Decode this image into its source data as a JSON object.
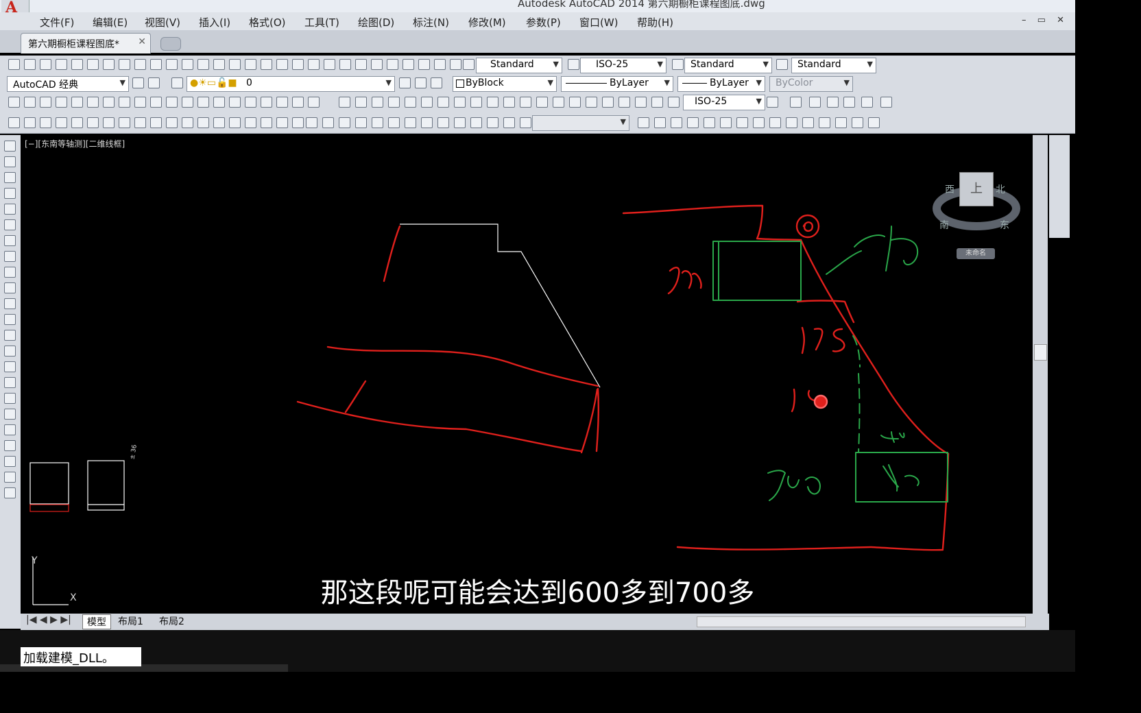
{
  "window": {
    "title": "Autodesk AutoCAD 2014    第六期橱柜课程图底.dwg",
    "controls": "– ▭ ✕"
  },
  "menu": [
    "文件(F)",
    "编辑(E)",
    "视图(V)",
    "插入(I)",
    "格式(O)",
    "工具(T)",
    "绘图(D)",
    "标注(N)",
    "修改(M)",
    "参数(P)",
    "窗口(W)",
    "帮助(H)"
  ],
  "tabs": {
    "document": "第六期橱柜课程图底*",
    "close": "✕"
  },
  "styles_toolbar": {
    "text_style": "Standard",
    "dim_style": "ISO-25",
    "table_style": "Standard",
    "multileader_style": "Standard"
  },
  "layers_toolbar": {
    "workspace": "AutoCAD 经典",
    "layer": "0",
    "color": "ByBlock",
    "linetype": "ByLayer",
    "lineweight": "ByLayer",
    "plotstyle": "ByColor"
  },
  "dim_toolbar": {
    "dim_style": "ISO-25"
  },
  "viewport": {
    "label": "[−][东南等轴测][二维线框]",
    "viewcube": {
      "top": "上",
      "north": "北",
      "west": "西",
      "south": "南",
      "east": "东",
      "wcs": "未命名"
    },
    "ucs": {
      "x": "X",
      "y": "Y"
    },
    "annotations": [
      "500",
      "700",
      "175",
      "10",
      "400",
      "500",
      "400"
    ]
  },
  "layout_tabs": [
    "模型",
    "布局1",
    "布局2"
  ],
  "command_line": "加载建模_DLL。",
  "subtitle": "那这段呢可能会达到600多到700多",
  "colors": {
    "sketch_red": "#e0201c",
    "sketch_green": "#2aa84a",
    "geometry_white": "#ffffff"
  }
}
